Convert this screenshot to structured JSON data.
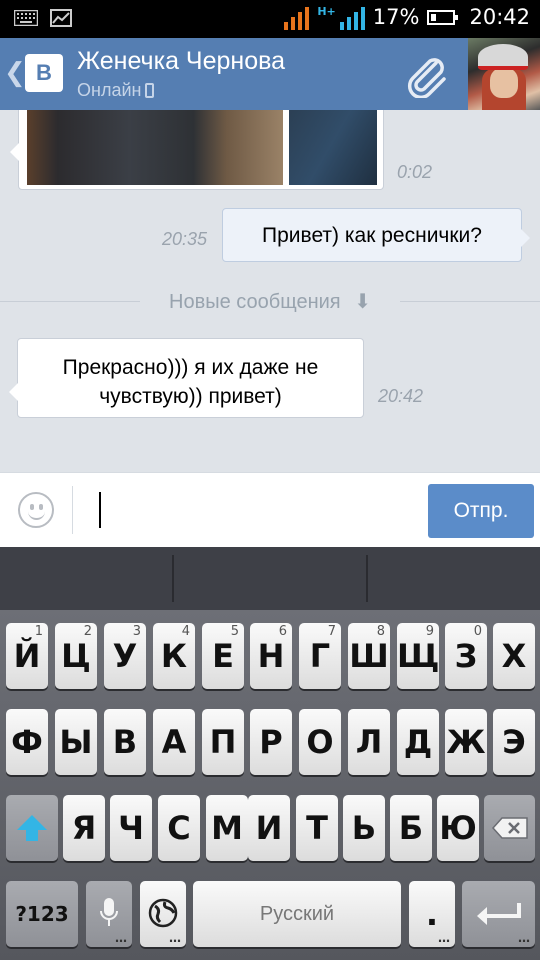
{
  "status_bar": {
    "battery": "17%",
    "time": "20:42",
    "network_label": "H+"
  },
  "header": {
    "title": "Женечка Чернова",
    "status": "Онлайн"
  },
  "messages": [
    {
      "type": "photo",
      "time": "0:02"
    },
    {
      "type": "outgoing",
      "text": "Привет) как реснички?",
      "time": "20:35"
    },
    {
      "type": "divider",
      "text": "Новые сообщения"
    },
    {
      "type": "incoming",
      "text_line1": "Прекрасно))) я их даже не",
      "text_line2": "чувствую)) привет)",
      "time": "20:42"
    }
  ],
  "composer": {
    "input_value": "",
    "send_label": "Отпр."
  },
  "keyboard": {
    "row1": [
      {
        "key": "Й",
        "hint": "1"
      },
      {
        "key": "Ц",
        "hint": "2"
      },
      {
        "key": "У",
        "hint": "3"
      },
      {
        "key": "К",
        "hint": "4"
      },
      {
        "key": "Е",
        "hint": "5"
      },
      {
        "key": "Н",
        "hint": "6"
      },
      {
        "key": "Г",
        "hint": "7"
      },
      {
        "key": "Ш",
        "hint": "8"
      },
      {
        "key": "Щ",
        "hint": "9"
      },
      {
        "key": "З",
        "hint": "0"
      },
      {
        "key": "Х",
        "hint": ""
      }
    ],
    "row2": [
      "Ф",
      "Ы",
      "В",
      "А",
      "П",
      "Р",
      "О",
      "Л",
      "Д",
      "Ж",
      "Э"
    ],
    "row3": [
      "Я",
      "Ч",
      "С",
      "М",
      "И",
      "Т",
      "Ь",
      "Б",
      "Ю"
    ],
    "numbers_label": "?123",
    "space_label": "Русский",
    "period_label": ".",
    "colors": {
      "shift_arrow": "#33b5e5"
    }
  },
  "colors": {
    "header": "#557eb2",
    "send_button": "#5b8cc9",
    "chat_bg": "#dfe3e8"
  }
}
